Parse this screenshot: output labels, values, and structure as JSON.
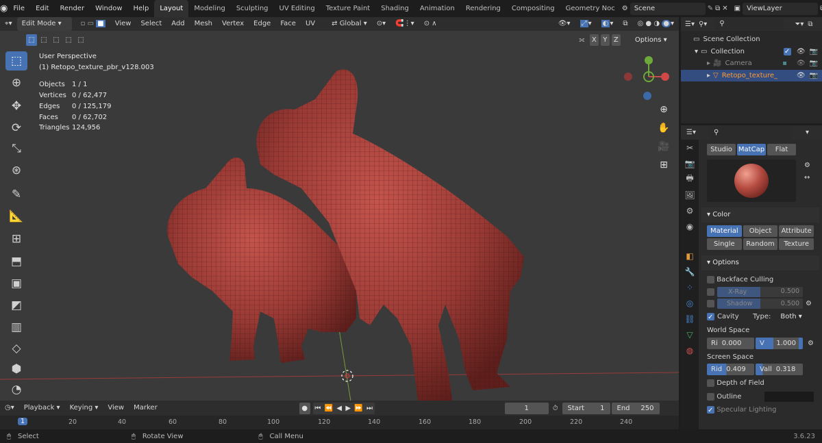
{
  "topbar": {
    "menus": [
      "File",
      "Edit",
      "Render",
      "Window",
      "Help"
    ],
    "workspaces": [
      "Layout",
      "Modeling",
      "Sculpting",
      "UV Editing",
      "Texture Paint",
      "Shading",
      "Animation",
      "Rendering",
      "Compositing",
      "Geometry Noc"
    ],
    "active_workspace": "Layout",
    "scene": "Scene",
    "view_layer": "ViewLayer"
  },
  "viewport_header": {
    "mode": "Edit Mode",
    "menus": [
      "View",
      "Select",
      "Add",
      "Mesh",
      "Vertex",
      "Edge",
      "Face",
      "UV"
    ],
    "orientation": "Global",
    "axes": [
      "X",
      "Y",
      "Z"
    ],
    "options": "Options"
  },
  "overlay": {
    "view_name": "User Perspective",
    "object_name": "(1) Retopo_texture_pbr_v128.003",
    "stats": [
      {
        "label": "Objects",
        "value": "1 / 1"
      },
      {
        "label": "Vertices",
        "value": "0 / 62,477"
      },
      {
        "label": "Edges",
        "value": "0 / 125,179"
      },
      {
        "label": "Faces",
        "value": "0 / 62,702"
      },
      {
        "label": "Triangles",
        "value": "124,956"
      }
    ]
  },
  "outliner": {
    "root": "Scene Collection",
    "collection": "Collection",
    "items": [
      {
        "label": "Camera",
        "selected": false
      },
      {
        "label": "Retopo_texture_",
        "selected": true
      }
    ]
  },
  "properties": {
    "lighting_tabs": [
      "Studio",
      "MatCap",
      "Flat"
    ],
    "active_lighting": "MatCap",
    "color_title": "Color",
    "color_buttons": [
      "Material",
      "Object",
      "Attribute",
      "Single",
      "Random",
      "Texture"
    ],
    "active_color": "Material",
    "options_title": "Options",
    "backface_culling": "Backface Culling",
    "xray_label": "X-Ray",
    "xray_value": "0.500",
    "shadow_label": "Shadow",
    "shadow_value": "0.500",
    "cavity_label": "Cavity",
    "type_label": "Type:",
    "type_value": "Both",
    "world_space": "World Space",
    "world_ridge_label": "Ri",
    "world_ridge_value": "0.000",
    "world_valley_label": "V",
    "world_valley_value": "1.000",
    "screen_space": "Screen Space",
    "screen_ridge_label": "Rid",
    "screen_ridge_value": "0.409",
    "screen_valley_label": "Vall",
    "screen_valley_value": "0.318",
    "depth_of_field": "Depth of Field",
    "outline": "Outline",
    "specular_lighting": "Specular Lighting"
  },
  "timeline": {
    "menus": [
      "Playback",
      "Keying",
      "View",
      "Marker"
    ],
    "current_frame": "1",
    "start_label": "Start",
    "start_value": "1",
    "end_label": "End",
    "end_value": "250",
    "ruler": [
      "1",
      "20",
      "40",
      "60",
      "80",
      "100",
      "120",
      "140",
      "160",
      "180",
      "200",
      "220",
      "240"
    ]
  },
  "statusbar": {
    "select": "Select",
    "rotate": "Rotate View",
    "call_menu": "Call Menu",
    "version": "3.6.23"
  },
  "colors": {
    "accent": "#4772b3",
    "model": "#a8403a",
    "viewport_bg": "#3a3a3a"
  }
}
